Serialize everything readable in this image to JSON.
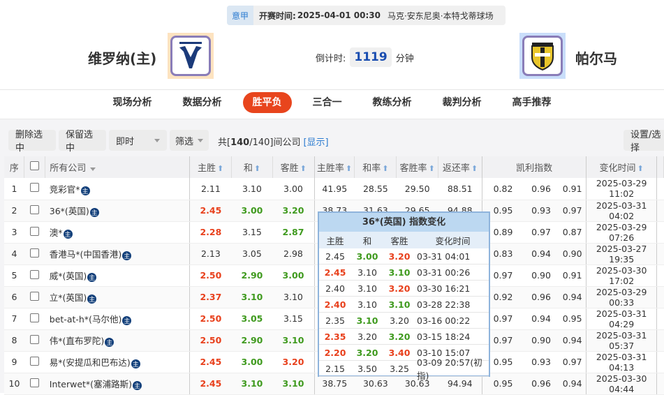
{
  "match": {
    "league": "意甲",
    "kickoff_label": "开赛时间:",
    "kickoff": "2025-04-01 00:30",
    "venue": "马克·安东尼奥·本特戈蒂球场",
    "home": "维罗纳(主)",
    "away": "帕尔马",
    "countdown_label": "倒计时:",
    "countdown": "1119",
    "countdown_unit": "分钟",
    "home_logo_text": "HELLAS VERONA FC"
  },
  "nav": [
    "现场分析",
    "数据分析",
    "胜平负",
    "三合一",
    "教练分析",
    "裁判分析",
    "高手推荐"
  ],
  "nav_active": 2,
  "toolbar": {
    "delete": "删除选中",
    "keep": "保留选中",
    "mode": "即时",
    "filter": "筛选",
    "total_prefix": "共[",
    "total_bold": "140",
    "total_rest": "/140]间公司",
    "show": "[显示]",
    "settings": "设置/选择"
  },
  "columns": [
    "序",
    "所有公司",
    "主胜",
    "和",
    "客胜",
    "主胜率",
    "和率",
    "客胜率",
    "返还率",
    "凯利指数",
    "变化时间"
  ],
  "badge": "主",
  "rows": [
    {
      "n": "1",
      "co": "竞彩官*",
      "o": [
        [
          "2.11",
          ""
        ],
        [
          "3.10",
          ""
        ],
        [
          "3.00",
          ""
        ]
      ],
      "r": [
        "41.95",
        "28.55",
        "29.50",
        "88.51"
      ],
      "k": [
        "0.82",
        "0.96",
        "0.91"
      ],
      "t": "2025-03-29 11:02"
    },
    {
      "n": "2",
      "co": "36*(英国)",
      "o": [
        [
          "2.45",
          "red"
        ],
        [
          "3.00",
          "green"
        ],
        [
          "3.20",
          "green"
        ]
      ],
      "r": [
        "38.73",
        "31.63",
        "29.65",
        "94.88"
      ],
      "k": [
        "0.95",
        "0.93",
        "0.97"
      ],
      "t": "2025-03-31 04:02"
    },
    {
      "n": "3",
      "co": "澳*",
      "o": [
        [
          "2.28",
          "red"
        ],
        [
          "3.15",
          ""
        ],
        [
          "2.87",
          "green"
        ]
      ],
      "r": [
        "",
        "",
        "",
        ""
      ],
      "k": [
        "0.89",
        "0.97",
        "0.87"
      ],
      "t": "2025-03-29 07:26"
    },
    {
      "n": "4",
      "co": "香港马*(中国香港)",
      "o": [
        [
          "2.13",
          ""
        ],
        [
          "3.05",
          ""
        ],
        [
          "2.98",
          ""
        ]
      ],
      "r": [
        "",
        "",
        "",
        ""
      ],
      "k": [
        "0.83",
        "0.94",
        "0.90"
      ],
      "t": "2025-03-27 19:35"
    },
    {
      "n": "5",
      "co": "威*(英国)",
      "o": [
        [
          "2.50",
          "red"
        ],
        [
          "2.90",
          "green"
        ],
        [
          "3.00",
          "green"
        ]
      ],
      "r": [
        "",
        "",
        "",
        ""
      ],
      "k": [
        "0.97",
        "0.90",
        "0.91"
      ],
      "t": "2025-03-30 17:02"
    },
    {
      "n": "6",
      "co": "立*(英国)",
      "o": [
        [
          "2.37",
          "red"
        ],
        [
          "3.10",
          "green"
        ],
        [
          "3.10",
          ""
        ]
      ],
      "r": [
        "",
        "",
        "",
        ""
      ],
      "k": [
        "0.92",
        "0.96",
        "0.94"
      ],
      "t": "2025-03-29 00:33"
    },
    {
      "n": "7",
      "co": "bet-at-h*(马尔他)",
      "o": [
        [
          "2.50",
          "red"
        ],
        [
          "3.05",
          "green"
        ],
        [
          "3.15",
          ""
        ]
      ],
      "r": [
        "",
        "",
        "",
        ""
      ],
      "k": [
        "0.97",
        "0.94",
        "0.95"
      ],
      "t": "2025-03-31 04:29"
    },
    {
      "n": "8",
      "co": "伟*(直布罗陀)",
      "o": [
        [
          "2.50",
          "red"
        ],
        [
          "2.90",
          "green"
        ],
        [
          "3.10",
          "green"
        ]
      ],
      "r": [
        "",
        "",
        "",
        ""
      ],
      "k": [
        "0.97",
        "0.90",
        "0.94"
      ],
      "t": "2025-03-31 05:37"
    },
    {
      "n": "9",
      "co": "易*(安提瓜和巴布达)",
      "o": [
        [
          "2.45",
          "red"
        ],
        [
          "3.00",
          "green"
        ],
        [
          "3.20",
          "red"
        ]
      ],
      "r": [
        "",
        "",
        "",
        ""
      ],
      "k": [
        "0.95",
        "0.93",
        "0.97"
      ],
      "t": "2025-03-31 04:13"
    },
    {
      "n": "10",
      "co": "Interwet*(塞浦路斯)",
      "o": [
        [
          "2.45",
          "red"
        ],
        [
          "3.10",
          "green"
        ],
        [
          "3.10",
          "green"
        ]
      ],
      "r": [
        "38.75",
        "30.63",
        "30.63",
        "94.94"
      ],
      "k": [
        "0.95",
        "0.96",
        "0.94"
      ],
      "t": "2025-03-30 04:44"
    }
  ],
  "tooltip": {
    "title": "36*(英国) 指数变化",
    "headers": [
      "主胜",
      "和",
      "客胜",
      "变化时间"
    ],
    "rows": [
      [
        [
          "2.45",
          ""
        ],
        [
          "3.00",
          "green"
        ],
        [
          "3.20",
          "red"
        ],
        "03-31 04:01"
      ],
      [
        [
          "2.45",
          "red"
        ],
        [
          "3.10",
          ""
        ],
        [
          "3.10",
          "green"
        ],
        "03-31 00:26"
      ],
      [
        [
          "2.40",
          ""
        ],
        [
          "3.10",
          ""
        ],
        [
          "3.20",
          "red"
        ],
        "03-30 16:21"
      ],
      [
        [
          "2.40",
          "red"
        ],
        [
          "3.10",
          ""
        ],
        [
          "3.10",
          "green"
        ],
        "03-28 22:38"
      ],
      [
        [
          "2.35",
          ""
        ],
        [
          "3.10",
          "green"
        ],
        [
          "3.20",
          ""
        ],
        "03-16 00:22"
      ],
      [
        [
          "2.35",
          "red"
        ],
        [
          "3.20",
          ""
        ],
        [
          "3.20",
          "green"
        ],
        "03-15 18:24"
      ],
      [
        [
          "2.20",
          "red"
        ],
        [
          "3.20",
          "green"
        ],
        [
          "3.40",
          "red"
        ],
        "03-10 15:07"
      ],
      [
        [
          "2.15",
          ""
        ],
        [
          "3.50",
          ""
        ],
        [
          "3.25",
          ""
        ],
        "03-09 20:57(初指)"
      ]
    ]
  },
  "colors": {
    "red": "#e8401c",
    "green": "#3f9a1e",
    "accent": "#e8451d",
    "link": "#2b7bd0"
  }
}
